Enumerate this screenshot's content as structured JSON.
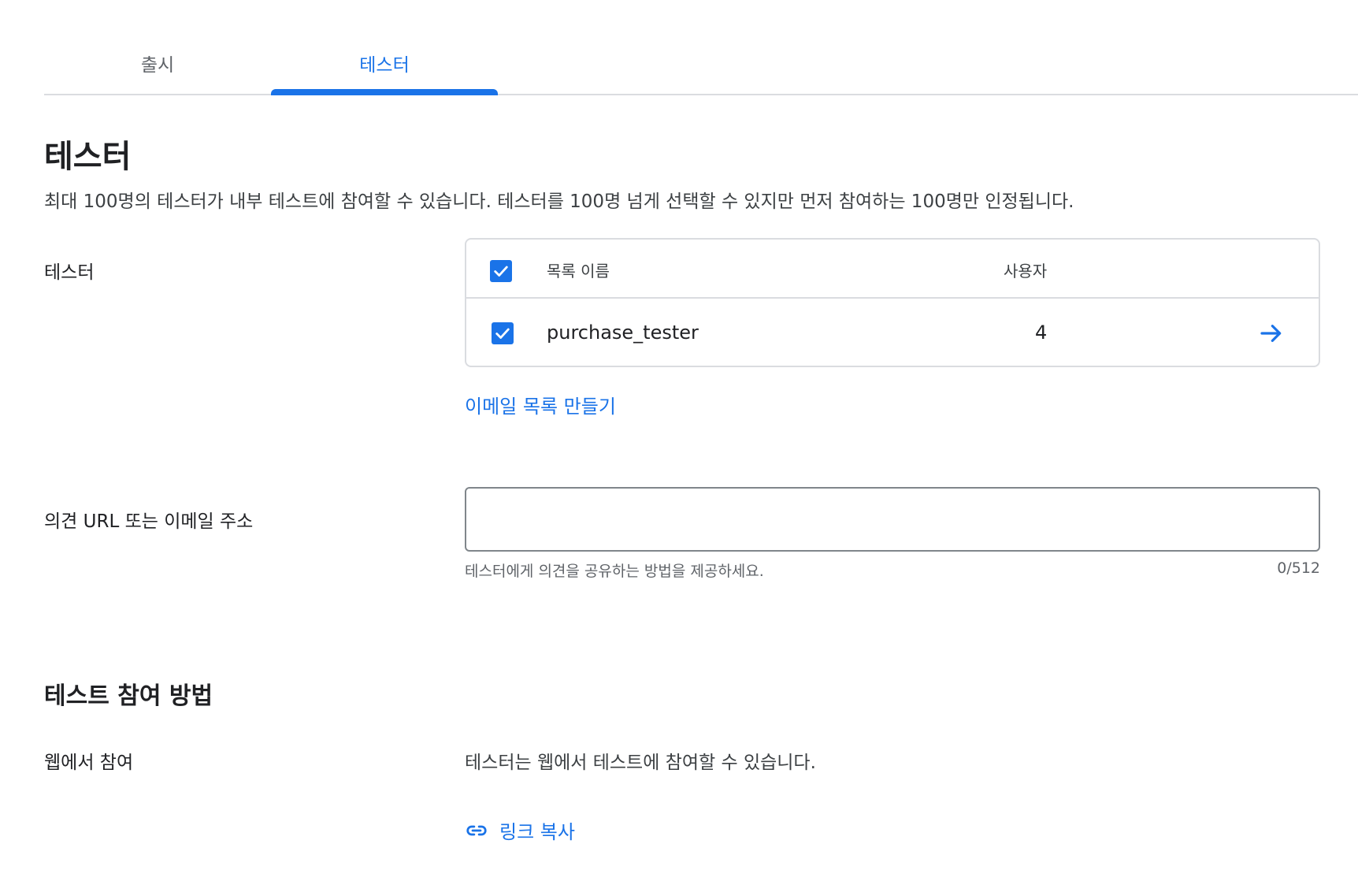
{
  "tabs": [
    {
      "label": "출시",
      "active": false
    },
    {
      "label": "테스터",
      "active": true
    }
  ],
  "section": {
    "title": "테스터",
    "description": "최대 100명의 테스터가 내부 테스트에 참여할 수 있습니다. 테스터를 100명 넘게 선택할 수 있지만 먼저 참여하는 100명만 인정됩니다."
  },
  "testers": {
    "label": "테스터",
    "table": {
      "columns": [
        "목록 이름",
        "사용자"
      ],
      "header_checked": true,
      "rows": [
        {
          "name": "purchase_tester",
          "users": "4",
          "checked": true
        }
      ]
    },
    "create_list_link": "이메일 목록 만들기"
  },
  "feedback": {
    "label": "의견 URL 또는 이메일 주소",
    "value": "",
    "helper": "테스터에게 의견을 공유하는 방법을 제공하세요.",
    "char_count": "0/512"
  },
  "how_to_join": {
    "title": "테스트 참여 방법",
    "web": {
      "label": "웹에서 참여",
      "description": "테스터는 웹에서 테스트에 참여할 수 있습니다.",
      "copy_link_label": "링크 복사"
    }
  },
  "colors": {
    "accent": "#1a73e8",
    "border": "#dadce0",
    "text": "#202124"
  }
}
